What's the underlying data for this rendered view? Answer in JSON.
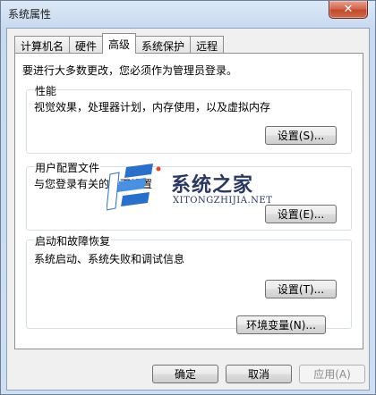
{
  "window": {
    "title": "系统属性",
    "close_glyph": "✕"
  },
  "tabs": [
    {
      "label": "计算机名",
      "active": false
    },
    {
      "label": "硬件",
      "active": false
    },
    {
      "label": "高级",
      "active": true
    },
    {
      "label": "系统保护",
      "active": false
    },
    {
      "label": "远程",
      "active": false
    }
  ],
  "advanced": {
    "admin_note": "要进行大多数更改，您必须作为管理员登录。",
    "performance": {
      "title": "性能",
      "description": "视觉效果，处理器计划，内存使用，以及虚拟内存",
      "button": "设置(S)..."
    },
    "user_profiles": {
      "title": "用户配置文件",
      "description": "与您登录有关的桌面设置",
      "button": "设置(E)..."
    },
    "startup_recovery": {
      "title": "启动和故障恢复",
      "description": "系统启动、系统失败和调试信息",
      "button": "设置(T)..."
    },
    "env_button": "环境变量(N)..."
  },
  "footer": {
    "ok": "确定",
    "cancel": "取消",
    "apply": "应用(A)"
  },
  "watermark": {
    "logo": "系统之家",
    "site": "XITONGZHIJIA.NET"
  },
  "colors": {
    "close_button": "#c8553a",
    "titlebar": "#d3e1f3",
    "panel": "#ffffff"
  }
}
